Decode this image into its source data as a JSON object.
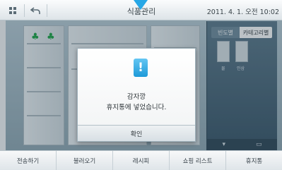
{
  "header": {
    "title": "식품관리",
    "datetime": "2011. 4. 1. 오전 10:02",
    "left_icons": [
      "grid-icon",
      "back-icon"
    ]
  },
  "right_panel": {
    "tabs": [
      {
        "label": "빈도별",
        "active": false
      },
      {
        "label": "카테고리별",
        "active": true
      }
    ],
    "items": [
      "물",
      "인삼"
    ]
  },
  "dialog": {
    "icon": "alert-icon",
    "line1": "감자깡",
    "line2": "휴지통에 넣었습니다.",
    "confirm_label": "확인"
  },
  "bottom_bar": {
    "buttons": [
      "전송하기",
      "불러오기",
      "레시피",
      "쇼핑 리스트",
      "휴지통"
    ]
  },
  "colors": {
    "accent": "#27a7e6",
    "panel": "#39576a"
  }
}
